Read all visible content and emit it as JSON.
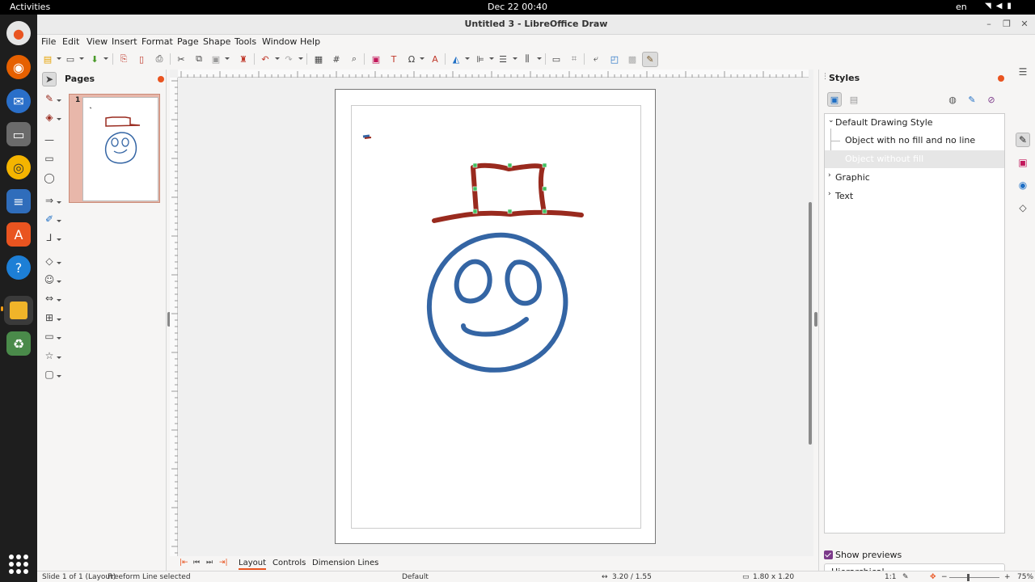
{
  "topbar": {
    "activities": "Activities",
    "clock": "Dec 22  00:40",
    "lang": "en",
    "tray_icons": [
      "wifi-icon",
      "volume-icon",
      "battery-icon"
    ]
  },
  "dock": {
    "apps": [
      "ubuntu-icon",
      "firefox-icon",
      "thunderbird-icon",
      "files-icon",
      "rhythmbox-icon",
      "writer-icon",
      "software-icon",
      "help-icon",
      "draw-icon",
      "trash-icon"
    ]
  },
  "window": {
    "title": "Untitled 3 - LibreOffice Draw"
  },
  "menu": [
    "File",
    "Edit",
    "View",
    "Insert",
    "Format",
    "Page",
    "Shape",
    "Tools",
    "Window",
    "Help"
  ],
  "pages_pane": {
    "title": "Pages",
    "thumbnail_number": "1"
  },
  "layer_tabs": [
    "Layout",
    "Controls",
    "Dimension Lines"
  ],
  "styles": {
    "title": "Styles",
    "items": [
      {
        "label": "Default Drawing Style",
        "expanded": true
      },
      {
        "label": "Object with no fill and no line"
      },
      {
        "label": "Object without fill",
        "selected": true
      },
      {
        "label": "Graphic",
        "expanded": false
      },
      {
        "label": "Text",
        "expanded": false
      }
    ],
    "show_previews": "Show previews",
    "filter_value": "Hierarchical"
  },
  "status": {
    "slide": "Slide 1 of 1 (Layout)",
    "selection": "Freeform Line selected",
    "page_style": "Default",
    "position": "3.20 / 1.55",
    "size": "1.80 x 1.20",
    "scale": "1:1",
    "zoom": "75%"
  },
  "colors": {
    "accent": "#e95420",
    "hat": "#992a1e",
    "face": "#3465a4",
    "handle": "#3fbf5f"
  }
}
